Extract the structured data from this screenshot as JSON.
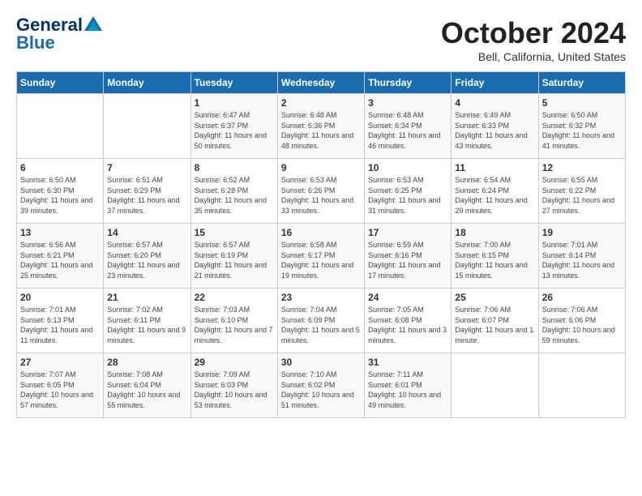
{
  "header": {
    "logo_general": "General",
    "logo_blue": "Blue",
    "month_title": "October 2024",
    "location": "Bell, California, United States"
  },
  "days_of_week": [
    "Sunday",
    "Monday",
    "Tuesday",
    "Wednesday",
    "Thursday",
    "Friday",
    "Saturday"
  ],
  "weeks": [
    [
      {
        "day": "",
        "info": ""
      },
      {
        "day": "",
        "info": ""
      },
      {
        "day": "1",
        "info": "Sunrise: 6:47 AM\nSunset: 6:37 PM\nDaylight: 11 hours and 50 minutes."
      },
      {
        "day": "2",
        "info": "Sunrise: 6:48 AM\nSunset: 6:36 PM\nDaylight: 11 hours and 48 minutes."
      },
      {
        "day": "3",
        "info": "Sunrise: 6:48 AM\nSunset: 6:34 PM\nDaylight: 11 hours and 46 minutes."
      },
      {
        "day": "4",
        "info": "Sunrise: 6:49 AM\nSunset: 6:33 PM\nDaylight: 11 hours and 43 minutes."
      },
      {
        "day": "5",
        "info": "Sunrise: 6:50 AM\nSunset: 6:32 PM\nDaylight: 11 hours and 41 minutes."
      }
    ],
    [
      {
        "day": "6",
        "info": "Sunrise: 6:50 AM\nSunset: 6:30 PM\nDaylight: 11 hours and 39 minutes."
      },
      {
        "day": "7",
        "info": "Sunrise: 6:51 AM\nSunset: 6:29 PM\nDaylight: 11 hours and 37 minutes."
      },
      {
        "day": "8",
        "info": "Sunrise: 6:52 AM\nSunset: 6:28 PM\nDaylight: 11 hours and 35 minutes."
      },
      {
        "day": "9",
        "info": "Sunrise: 6:53 AM\nSunset: 6:26 PM\nDaylight: 11 hours and 33 minutes."
      },
      {
        "day": "10",
        "info": "Sunrise: 6:53 AM\nSunset: 6:25 PM\nDaylight: 11 hours and 31 minutes."
      },
      {
        "day": "11",
        "info": "Sunrise: 6:54 AM\nSunset: 6:24 PM\nDaylight: 11 hours and 29 minutes."
      },
      {
        "day": "12",
        "info": "Sunrise: 6:55 AM\nSunset: 6:22 PM\nDaylight: 11 hours and 27 minutes."
      }
    ],
    [
      {
        "day": "13",
        "info": "Sunrise: 6:56 AM\nSunset: 6:21 PM\nDaylight: 11 hours and 25 minutes."
      },
      {
        "day": "14",
        "info": "Sunrise: 6:57 AM\nSunset: 6:20 PM\nDaylight: 11 hours and 23 minutes."
      },
      {
        "day": "15",
        "info": "Sunrise: 6:57 AM\nSunset: 6:19 PM\nDaylight: 11 hours and 21 minutes."
      },
      {
        "day": "16",
        "info": "Sunrise: 6:58 AM\nSunset: 6:17 PM\nDaylight: 11 hours and 19 minutes."
      },
      {
        "day": "17",
        "info": "Sunrise: 6:59 AM\nSunset: 6:16 PM\nDaylight: 11 hours and 17 minutes."
      },
      {
        "day": "18",
        "info": "Sunrise: 7:00 AM\nSunset: 6:15 PM\nDaylight: 11 hours and 15 minutes."
      },
      {
        "day": "19",
        "info": "Sunrise: 7:01 AM\nSunset: 6:14 PM\nDaylight: 11 hours and 13 minutes."
      }
    ],
    [
      {
        "day": "20",
        "info": "Sunrise: 7:01 AM\nSunset: 6:13 PM\nDaylight: 11 hours and 11 minutes."
      },
      {
        "day": "21",
        "info": "Sunrise: 7:02 AM\nSunset: 6:11 PM\nDaylight: 11 hours and 9 minutes."
      },
      {
        "day": "22",
        "info": "Sunrise: 7:03 AM\nSunset: 6:10 PM\nDaylight: 11 hours and 7 minutes."
      },
      {
        "day": "23",
        "info": "Sunrise: 7:04 AM\nSunset: 6:09 PM\nDaylight: 11 hours and 5 minutes."
      },
      {
        "day": "24",
        "info": "Sunrise: 7:05 AM\nSunset: 6:08 PM\nDaylight: 11 hours and 3 minutes."
      },
      {
        "day": "25",
        "info": "Sunrise: 7:06 AM\nSunset: 6:07 PM\nDaylight: 11 hours and 1 minute."
      },
      {
        "day": "26",
        "info": "Sunrise: 7:06 AM\nSunset: 6:06 PM\nDaylight: 10 hours and 59 minutes."
      }
    ],
    [
      {
        "day": "27",
        "info": "Sunrise: 7:07 AM\nSunset: 6:05 PM\nDaylight: 10 hours and 57 minutes."
      },
      {
        "day": "28",
        "info": "Sunrise: 7:08 AM\nSunset: 6:04 PM\nDaylight: 10 hours and 55 minutes."
      },
      {
        "day": "29",
        "info": "Sunrise: 7:09 AM\nSunset: 6:03 PM\nDaylight: 10 hours and 53 minutes."
      },
      {
        "day": "30",
        "info": "Sunrise: 7:10 AM\nSunset: 6:02 PM\nDaylight: 10 hours and 51 minutes."
      },
      {
        "day": "31",
        "info": "Sunrise: 7:11 AM\nSunset: 6:01 PM\nDaylight: 10 hours and 49 minutes."
      },
      {
        "day": "",
        "info": ""
      },
      {
        "day": "",
        "info": ""
      }
    ]
  ]
}
